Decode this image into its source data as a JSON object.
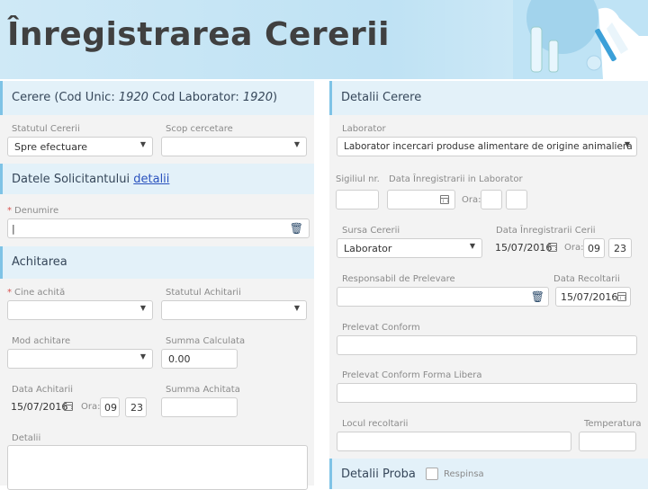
{
  "banner": {
    "title": "Înregistrarea Cererii"
  },
  "left": {
    "cerere": {
      "prefix": "Cerere (Cod Unic: ",
      "cod_unic": "1920",
      "mid": " Cod Laborator: ",
      "cod_laborator": "1920",
      "suffix": ")"
    },
    "statutul_cererii": {
      "label": "Statutul Cererii",
      "value": "Spre efectuare"
    },
    "scop_cercetare": {
      "label": "Scop cercetare",
      "value": ""
    },
    "datele_solicitantului": {
      "title": "Datele Solicitantului",
      "link": "detalii"
    },
    "denumire": {
      "label": "Denumire",
      "value": "|"
    },
    "achitarea": {
      "title": "Achitarea"
    },
    "cine_achita": {
      "label": "Cine achită",
      "value": ""
    },
    "statutul_achitarii": {
      "label": "Statutul Achitarii",
      "value": ""
    },
    "mod_achitare": {
      "label": "Mod achitare",
      "value": ""
    },
    "summa_calculata": {
      "label": "Summa Calculata",
      "value": "0.00"
    },
    "data_achitarii": {
      "label": "Data Achitarii",
      "value": "15/07/2016",
      "ora_label": "Ora:",
      "hour": "09",
      "minute": "23"
    },
    "summa_achitata": {
      "label": "Summa Achitata",
      "value": ""
    },
    "detalii": {
      "label": "Detalii"
    }
  },
  "right": {
    "detalii_cerere": {
      "title": "Detalii Cerere"
    },
    "laborator": {
      "label": "Laborator",
      "value": "Laborator incercari produse alimentare de origine animaliera"
    },
    "sigiliul": {
      "label": "Sigiliul nr.",
      "value": ""
    },
    "data_inreg_lab": {
      "label": "Data Înregistrarii in Laborator",
      "value": "",
      "ora_label": "Ora:"
    },
    "sursa_cererii": {
      "label": "Sursa Cererii",
      "value": "Laborator"
    },
    "data_inreg_cerii": {
      "label": "Data Înregistrarii Cerii",
      "value": "15/07/2016",
      "ora_label": "Ora:",
      "hour": "09",
      "minute": "23"
    },
    "responsabil": {
      "label": "Responsabil de Prelevare",
      "value": ""
    },
    "data_recoltarii": {
      "label": "Data Recoltarii",
      "value": "15/07/2016"
    },
    "prelevat_conform": {
      "label": "Prelevat Conform",
      "value": ""
    },
    "prelevat_forma_libera": {
      "label": "Prelevat Conform Forma Libera",
      "value": ""
    },
    "locul_recoltarii": {
      "label": "Locul recoltarii",
      "value": ""
    },
    "temperatura": {
      "label": "Temperatura",
      "value": ""
    },
    "detalii_proba": {
      "title": "Detalii Proba",
      "checkbox_label": "Respinsa"
    }
  },
  "icons": {
    "caret": "caret-down-icon",
    "calendar": "calendar-icon",
    "trash": "trash-icon"
  },
  "colors": {
    "section_header": "#e3f1f9",
    "accent_border": "#7ec3e6",
    "banner": "#cfe9f6",
    "required": "#d9534f"
  }
}
